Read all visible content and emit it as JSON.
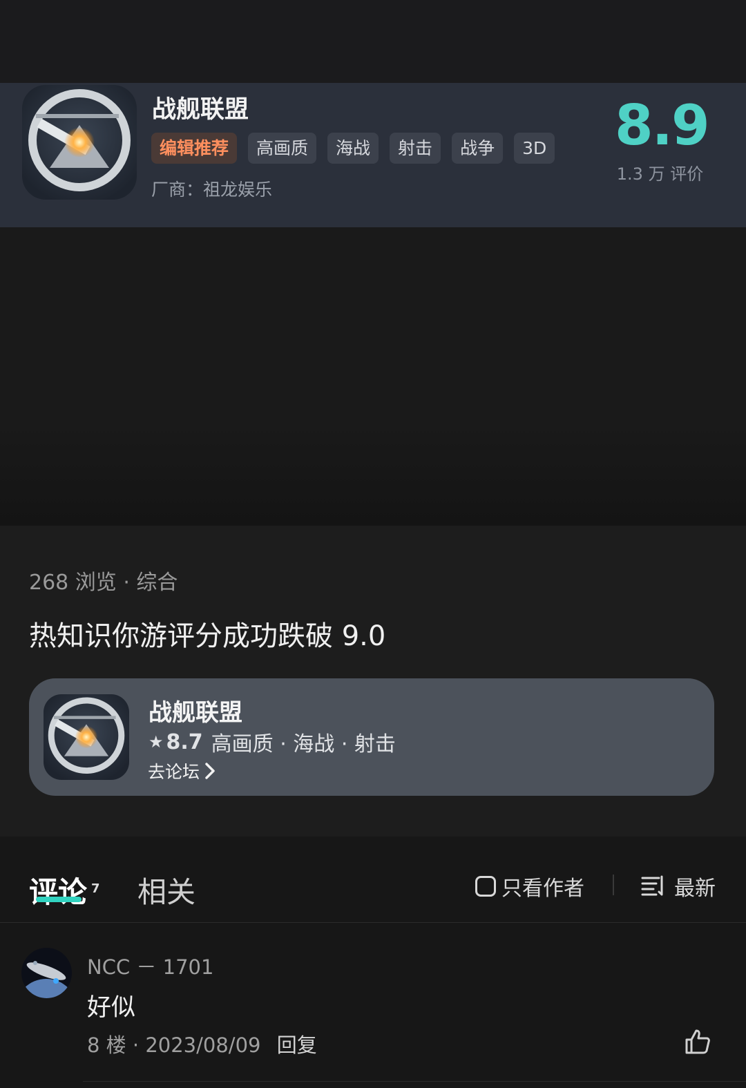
{
  "game": {
    "title": "战舰联盟",
    "tags": [
      "编辑推荐",
      "高画质",
      "海战",
      "射击",
      "战争",
      "3D"
    ],
    "vendor": "厂商：祖龙娱乐",
    "score": "8.9",
    "rating_count": "1.3 万 评价"
  },
  "post": {
    "meta": "268 浏览 · 综合",
    "title": "热知识你游评分成功跌破 9.0",
    "card": {
      "title": "战舰联盟",
      "star": "★",
      "score": "8.7",
      "tags": "高画质 · 海战 · 射击",
      "link": "去论坛"
    }
  },
  "comments_bar": {
    "tab_comments": "评论",
    "count": "7",
    "tab_related": "相关",
    "author_only": "只看作者",
    "sort": "最新"
  },
  "comment": {
    "user": "NCC － 1701",
    "text": "好似",
    "meta": "8 楼 · 2023/08/09",
    "reply": "回复"
  },
  "colors": {
    "accent": "#4fd1c5",
    "tab_underline": "#31d3c0",
    "editor_tag": "#ff8f5e"
  }
}
